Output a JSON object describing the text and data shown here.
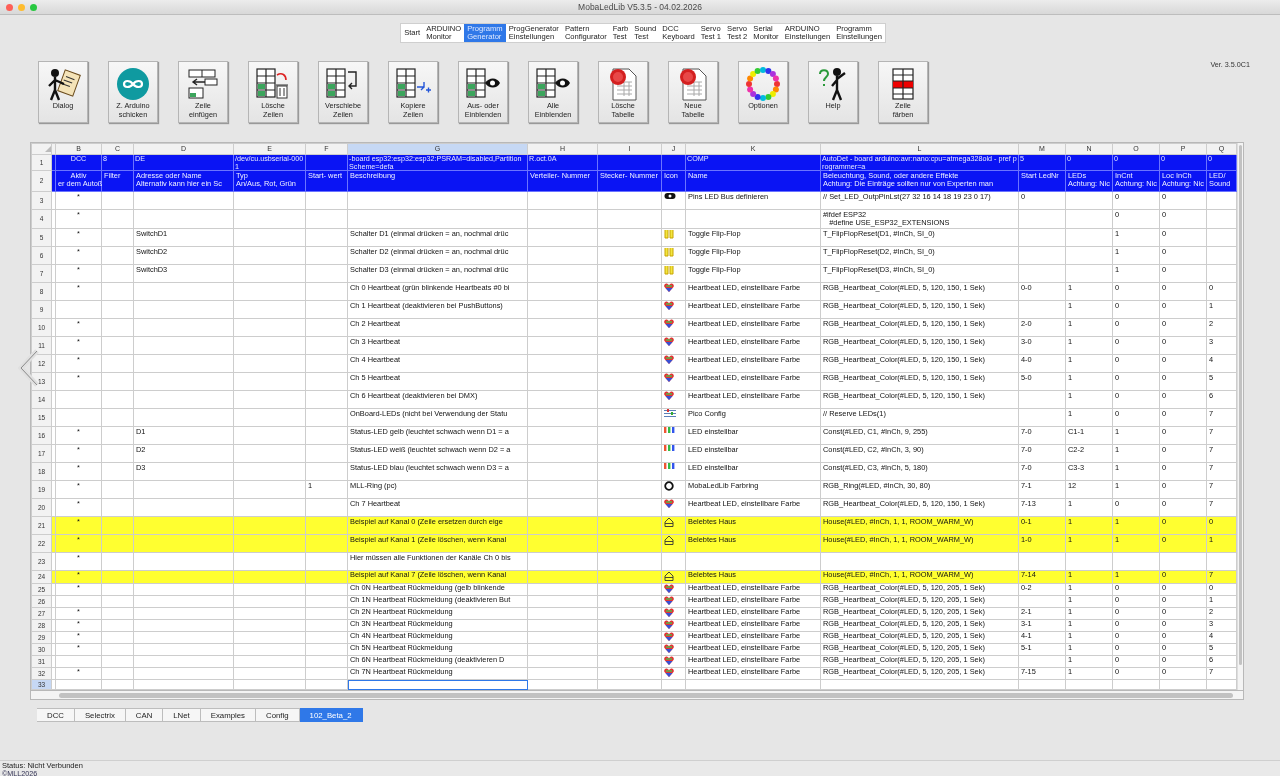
{
  "window": {
    "title": "MobaLedLib V5.3.5 - 04.02.2026"
  },
  "tabs": [
    {
      "label": "Start",
      "selected": false
    },
    {
      "label": "ARDUINO\nMonitor",
      "selected": false
    },
    {
      "label": "Programm\nGenerator",
      "selected": true
    },
    {
      "label": "ProgGenerator\nEinstellungen",
      "selected": false
    },
    {
      "label": "Pattern\nConfigurator",
      "selected": false
    },
    {
      "label": "Farb\nTest",
      "selected": false
    },
    {
      "label": "Sound\nTest",
      "selected": false
    },
    {
      "label": "DCC\nKeyboard",
      "selected": false
    },
    {
      "label": "Servo\nTest 1",
      "selected": false
    },
    {
      "label": "Servo\nTest 2",
      "selected": false
    },
    {
      "label": "Serial\nMonitor",
      "selected": false
    },
    {
      "label": "ARDUINO\nEinstellungen",
      "selected": false
    },
    {
      "label": "Programm\nEinstellungen",
      "selected": false
    }
  ],
  "toolbar": {
    "version": "Ver. 3.5.0C1",
    "buttons": [
      {
        "label": "Dialog",
        "kind": "dialog"
      },
      {
        "label": "Z. Arduino\nschicken",
        "kind": "arduino"
      },
      {
        "label": "Zeile\neinfügen",
        "kind": "insert"
      },
      {
        "label": "Lösche\nZeilen",
        "kind": "trash"
      },
      {
        "label": "Verschiebe\nZeilen",
        "kind": "move"
      },
      {
        "label": "Kopiere\nZeilen",
        "kind": "copy"
      },
      {
        "label": "Aus- oder\nEinblenden",
        "kind": "eye"
      },
      {
        "label": "Alle\nEinblenden",
        "kind": "eye"
      },
      {
        "label": "Lösche\nTabelle",
        "kind": "document"
      },
      {
        "label": "Neue\nTabelle",
        "kind": "document"
      },
      {
        "label": "Optionen",
        "kind": "ring"
      },
      {
        "label": "Help",
        "kind": "help"
      },
      {
        "label": "Zeile\nfärben",
        "kind": "color"
      }
    ]
  },
  "sheet": {
    "columns": [
      {
        "letter": "B",
        "selected": false
      },
      {
        "letter": "C",
        "selected": false
      },
      {
        "letter": "D",
        "selected": false
      },
      {
        "letter": "E",
        "selected": false
      },
      {
        "letter": "F",
        "selected": false
      },
      {
        "letter": "G",
        "selected": true
      },
      {
        "letter": "H",
        "selected": false
      },
      {
        "letter": "I",
        "selected": false
      },
      {
        "letter": "J",
        "selected": false
      },
      {
        "letter": "K",
        "selected": false
      },
      {
        "letter": "L",
        "selected": false
      },
      {
        "letter": "M",
        "selected": false
      },
      {
        "letter": "N",
        "selected": false
      },
      {
        "letter": "O",
        "selected": false
      },
      {
        "letter": "P",
        "selected": false
      },
      {
        "letter": "Q",
        "selected": false
      }
    ],
    "rows": [
      {
        "number": "1",
        "kind": "config",
        "highlighted": false,
        "selected": false,
        "cells": {
          "B": "DCC",
          "C": "8",
          "D": "DE",
          "E": "/dev/cu.usbserial-0001",
          "G": "-board esp32:esp32:esp32:PSRAM=disabled,PartitionScheme=defa",
          "H": "R.oct.0A",
          "K": "COMP",
          "L": "AutoDet - board arduino:avr:nano:cpu=atmega328old - pref programmer=a",
          "M": "5",
          "N": "0",
          "O": "0",
          "P": "0",
          "Q": "0"
        }
      },
      {
        "number": "2",
        "kind": "header",
        "highlighted": false,
        "selected": false,
        "cells": {
          "B": "Aktiv\ner dem Autoß",
          "C": "Filter",
          "D": "Adresse oder Name\nAlternativ kann hier ein Sc",
          "E": "Typ\nAn/Aus, Rot, Grün",
          "F": "Start- wert",
          "G": "Beschreibung",
          "H": "Verteiler- Nummer",
          "I": "Stecker- Nummer",
          "J": "Icon",
          "K": "Name",
          "L": "Beleuchtung, Sound, oder andere Effekte\nAchtung: Die Einträge sollten nur von Experten man",
          "M": "Start LedNr",
          "N": "LEDs\nAchtung: Nic",
          "O": "InCnt\nAchtung: Nic",
          "P": "Loc InCh\nAchtung: Nic",
          "Q": "LED/\nSound"
        }
      },
      {
        "number": "3",
        "kind": "pill",
        "highlighted": false,
        "selected": false,
        "cells": {
          "B": "*",
          "K": "Pins LED Bus definieren",
          "L": "// Set_LED_OutpPinLst(27 32 16 14 18 19 23 0 17)",
          "M": "0",
          "O": "0",
          "P": "0"
        }
      },
      {
        "number": "4",
        "kind": "text",
        "highlighted": false,
        "selected": false,
        "cells": {
          "B": "*",
          "L": "#ifdef ESP32\n   #define USE_ESP32_EXTENSIONS",
          "O": "0",
          "P": "0"
        }
      },
      {
        "number": "5",
        "kind": "flipflop",
        "highlighted": false,
        "selected": false,
        "cells": {
          "B": "*",
          "D": "SwitchD1",
          "G": "Schalter D1 (einmal drücken = an, nochmal drüc",
          "K": "Toggle Flip-Flop",
          "L": "T_FlipFlopReset(D1, #InCh, SI_0)",
          "O": "1",
          "P": "0"
        }
      },
      {
        "number": "6",
        "kind": "flipflop",
        "highlighted": false,
        "selected": false,
        "cells": {
          "B": "*",
          "D": "SwitchD2",
          "G": "Schalter D2 (einmal drücken = an, nochmal drüc",
          "K": "Toggle Flip-Flop",
          "L": "T_FlipFlopReset(D2, #InCh, SI_0)",
          "O": "1",
          "P": "0"
        }
      },
      {
        "number": "7",
        "kind": "flipflop",
        "highlighted": false,
        "selected": false,
        "cells": {
          "B": "*",
          "D": "SwitchD3",
          "G": "Schalter D3 (einmal drücken = an, nochmal drüc",
          "K": "Toggle Flip-Flop",
          "L": "T_FlipFlopReset(D3, #InCh, SI_0)",
          "O": "1",
          "P": "0"
        }
      },
      {
        "number": "8",
        "kind": "heart",
        "highlighted": false,
        "selected": false,
        "cells": {
          "B": "*",
          "G": "Ch 0 Heartbeat (grün blinkende Heartbeats #0 bi",
          "K": "Heartbeat LED, einstellbare Farbe",
          "L": "RGB_Heartbeat_Color(#LED, 5, 120, 150, 1 Sek)",
          "M": "0-0",
          "N": "1",
          "O": "0",
          "P": "0",
          "Q": "0"
        }
      },
      {
        "number": "9",
        "kind": "heart",
        "highlighted": false,
        "selected": false,
        "cells": {
          "G": "Ch 1 Heartbeat (deaktivieren bei PushButtons)",
          "K": "Heartbeat LED, einstellbare Farbe",
          "L": "RGB_Heartbeat_Color(#LED, 5, 120, 150, 1 Sek)",
          "N": "1",
          "O": "0",
          "P": "0",
          "Q": "1"
        }
      },
      {
        "number": "10",
        "kind": "heart",
        "highlighted": false,
        "selected": false,
        "cells": {
          "B": "*",
          "G": "Ch 2 Heartbeat",
          "K": "Heartbeat LED, einstellbare Farbe",
          "L": "RGB_Heartbeat_Color(#LED, 5, 120, 150, 1 Sek)",
          "M": "2-0",
          "N": "1",
          "O": "0",
          "P": "0",
          "Q": "2"
        }
      },
      {
        "number": "11",
        "kind": "heart",
        "highlighted": false,
        "selected": false,
        "cells": {
          "B": "*",
          "G": "Ch 3 Heartbeat",
          "K": "Heartbeat LED, einstellbare Farbe",
          "L": "RGB_Heartbeat_Color(#LED, 5, 120, 150, 1 Sek)",
          "M": "3-0",
          "N": "1",
          "O": "0",
          "P": "0",
          "Q": "3"
        }
      },
      {
        "number": "12",
        "kind": "heart",
        "highlighted": false,
        "selected": false,
        "cells": {
          "B": "*",
          "G": "Ch 4 Heartbeat",
          "K": "Heartbeat LED, einstellbare Farbe",
          "L": "RGB_Heartbeat_Color(#LED, 5, 120, 150, 1 Sek)",
          "M": "4-0",
          "N": "1",
          "O": "0",
          "P": "0",
          "Q": "4"
        }
      },
      {
        "number": "13",
        "kind": "heart",
        "highlighted": false,
        "selected": false,
        "cells": {
          "B": "*",
          "G": "Ch 5 Heartbeat",
          "K": "Heartbeat LED, einstellbare Farbe",
          "L": "RGB_Heartbeat_Color(#LED, 5, 120, 150, 1 Sek)",
          "M": "5-0",
          "N": "1",
          "O": "0",
          "P": "0",
          "Q": "5"
        }
      },
      {
        "number": "14",
        "kind": "heart",
        "highlighted": false,
        "selected": false,
        "cells": {
          "G": "Ch 6 Heartbeat (deaktivieren bei DMX)",
          "K": "Heartbeat LED, einstellbare Farbe",
          "L": "RGB_Heartbeat_Color(#LED, 5, 120, 150, 1 Sek)",
          "N": "1",
          "O": "0",
          "P": "0",
          "Q": "6"
        }
      },
      {
        "number": "15",
        "kind": "config-lines",
        "highlighted": false,
        "selected": false,
        "cells": {
          "G": "OnBoard-LEDs (nicht bei Verwendung der Statu",
          "K": "Pico Config",
          "L": "// Reserve LEDs(1)",
          "N": "1",
          "O": "0",
          "P": "0",
          "Q": "7"
        }
      },
      {
        "number": "16",
        "kind": "leds",
        "highlighted": false,
        "selected": false,
        "cells": {
          "B": "*",
          "D": "D1",
          "G": "Status-LED gelb (leuchtet schwach wenn D1 = a",
          "K": "LED einstellbar",
          "L": "Const(#LED, C1, #InCh, 9, 255)",
          "M": "7-0",
          "N": "C1-1",
          "O": "1",
          "P": "0",
          "Q": "7"
        }
      },
      {
        "number": "17",
        "kind": "leds",
        "highlighted": false,
        "selected": false,
        "cells": {
          "B": "*",
          "D": "D2",
          "G": "Status-LED weiß (leuchtet schwach wenn D2 = a",
          "K": "LED einstellbar",
          "L": "Const(#LED, C2, #InCh, 3, 90)",
          "M": "7-0",
          "N": "C2-2",
          "O": "1",
          "P": "0",
          "Q": "7"
        }
      },
      {
        "number": "18",
        "kind": "leds",
        "highlighted": false,
        "selected": false,
        "cells": {
          "B": "*",
          "D": "D3",
          "G": "Status-LED blau (leuchtet schwach wenn D3 = a",
          "K": "LED einstellbar",
          "L": "Const(#LED, C3, #InCh, 5, 180)",
          "M": "7-0",
          "N": "C3-3",
          "O": "1",
          "P": "0",
          "Q": "7"
        }
      },
      {
        "number": "19",
        "kind": "ring",
        "highlighted": false,
        "selected": false,
        "cells": {
          "B": "*",
          "F": "1",
          "G": "MLL-Ring (pc)",
          "K": "MobaLedLib Farbring",
          "L": "RGB_Ring(#LED, #InCh, 30, 80)",
          "M": "7-1",
          "N": "12",
          "O": "1",
          "P": "0",
          "Q": "7"
        }
      },
      {
        "number": "20",
        "kind": "heart",
        "highlighted": false,
        "selected": false,
        "cells": {
          "B": "*",
          "G": "Ch 7 Heartbeat",
          "K": "Heartbeat LED, einstellbare Farbe",
          "L": "RGB_Heartbeat_Color(#LED, 5, 120, 150, 1 Sek)",
          "M": "7-13",
          "N": "1",
          "O": "0",
          "P": "0",
          "Q": "7"
        }
      },
      {
        "number": "21",
        "kind": "house",
        "highlighted": true,
        "selected": false,
        "cells": {
          "B": "*",
          "G": "Beispiel auf Kanal 0 (Zeile ersetzen durch eige",
          "K": "Belebtes Haus",
          "L": "House(#LED, #InCh, 1, 1, ROOM_WARM_W)",
          "M": "0-1",
          "N": "1",
          "O": "1",
          "P": "0",
          "Q": "0"
        }
      },
      {
        "number": "22",
        "kind": "house",
        "highlighted": true,
        "selected": false,
        "cells": {
          "B": "*",
          "G": "Beispiel auf Kanal 1 (Zeile löschen, wenn Kanal",
          "K": "Belebtes Haus",
          "L": "House(#LED, #InCh, 1, 1, ROOM_WARM_W)",
          "M": "1-0",
          "N": "1",
          "O": "1",
          "P": "0",
          "Q": "1"
        }
      },
      {
        "number": "23",
        "kind": "text",
        "highlighted": false,
        "selected": false,
        "cells": {
          "B": "*",
          "G": "Hier müssen alle Funktionen der Kanäle Ch 0 bis"
        }
      },
      {
        "number": "24",
        "kind": "house",
        "highlighted": true,
        "selected": false,
        "cells": {
          "B": "*",
          "G": "Beispiel auf Kanal 7 (Zeile löschen, wenn Kanal",
          "K": "Belebtes Haus",
          "L": "House(#LED, #InCh, 1, 1, ROOM_WARM_W)",
          "M": "7-14",
          "N": "1",
          "O": "1",
          "P": "0",
          "Q": "7"
        }
      },
      {
        "number": "25",
        "kind": "heart",
        "highlighted": false,
        "selected": false,
        "cells": {
          "B": "*",
          "G": "Ch 0N Heartbeat Rückmeldung (gelb blinkende",
          "K": "Heartbeat LED, einstellbare Farbe",
          "L": "RGB_Heartbeat_Color(#LED, 5, 120, 205, 1 Sek)",
          "M": "0-2",
          "N": "1",
          "O": "0",
          "P": "0",
          "Q": "0"
        }
      },
      {
        "number": "26",
        "kind": "heart",
        "highlighted": false,
        "selected": false,
        "cells": {
          "G": "Ch 1N Heartbeat Rückmeldung (deaktivieren But",
          "K": "Heartbeat LED, einstellbare Farbe",
          "L": "RGB_Heartbeat_Color(#LED, 5, 120, 205, 1 Sek)",
          "N": "1",
          "O": "0",
          "P": "0",
          "Q": "1"
        }
      },
      {
        "number": "27",
        "kind": "heart",
        "highlighted": false,
        "selected": false,
        "cells": {
          "B": "*",
          "G": "Ch 2N Heartbeat Rückmeldung",
          "K": "Heartbeat LED, einstellbare Farbe",
          "L": "RGB_Heartbeat_Color(#LED, 5, 120, 205, 1 Sek)",
          "M": "2-1",
          "N": "1",
          "O": "0",
          "P": "0",
          "Q": "2"
        }
      },
      {
        "number": "28",
        "kind": "heart",
        "highlighted": false,
        "selected": false,
        "cells": {
          "B": "*",
          "G": "Ch 3N Heartbeat Rückmeldung",
          "K": "Heartbeat LED, einstellbare Farbe",
          "L": "RGB_Heartbeat_Color(#LED, 5, 120, 205, 1 Sek)",
          "M": "3-1",
          "N": "1",
          "O": "0",
          "P": "0",
          "Q": "3"
        }
      },
      {
        "number": "29",
        "kind": "heart",
        "highlighted": false,
        "selected": false,
        "cells": {
          "B": "*",
          "G": "Ch 4N Heartbeat Rückmeldung",
          "K": "Heartbeat LED, einstellbare Farbe",
          "L": "RGB_Heartbeat_Color(#LED, 5, 120, 205, 1 Sek)",
          "M": "4-1",
          "N": "1",
          "O": "0",
          "P": "0",
          "Q": "4"
        }
      },
      {
        "number": "30",
        "kind": "heart",
        "highlighted": false,
        "selected": false,
        "cells": {
          "B": "*",
          "G": "Ch 5N Heartbeat Rückmeldung",
          "K": "Heartbeat LED, einstellbare Farbe",
          "L": "RGB_Heartbeat_Color(#LED, 5, 120, 205, 1 Sek)",
          "M": "5-1",
          "N": "1",
          "O": "0",
          "P": "0",
          "Q": "5"
        }
      },
      {
        "number": "31",
        "kind": "heart",
        "highlighted": false,
        "selected": false,
        "cells": {
          "G": "Ch 6N Heartbeat Rückmeldung (deaktivieren D",
          "K": "Heartbeat LED, einstellbare Farbe",
          "L": "RGB_Heartbeat_Color(#LED, 5, 120, 205, 1 Sek)",
          "N": "1",
          "O": "0",
          "P": "0",
          "Q": "6"
        }
      },
      {
        "number": "32",
        "kind": "heart",
        "highlighted": false,
        "selected": false,
        "cells": {
          "B": "*",
          "G": "Ch 7N Heartbeat Rückmeldung",
          "K": "Heartbeat LED, einstellbare Farbe",
          "L": "RGB_Heartbeat_Color(#LED, 5, 120, 205, 1 Sek)",
          "M": "7-15",
          "N": "1",
          "O": "0",
          "P": "0",
          "Q": "7"
        }
      },
      {
        "number": "33",
        "kind": "text",
        "highlighted": false,
        "selected": true,
        "cells": {}
      }
    ]
  },
  "sheet_tabs": [
    {
      "label": "DCC",
      "selected": false
    },
    {
      "label": "Selectrix",
      "selected": false
    },
    {
      "label": "CAN",
      "selected": false
    },
    {
      "label": "LNet",
      "selected": false
    },
    {
      "label": "Examples",
      "selected": false
    },
    {
      "label": "Config",
      "selected": false
    },
    {
      "label": "102_Beta_2",
      "selected": true
    }
  ],
  "status_bar": {
    "status": "Status: Nicht Verbunden",
    "copyright": "©MLL2026"
  }
}
